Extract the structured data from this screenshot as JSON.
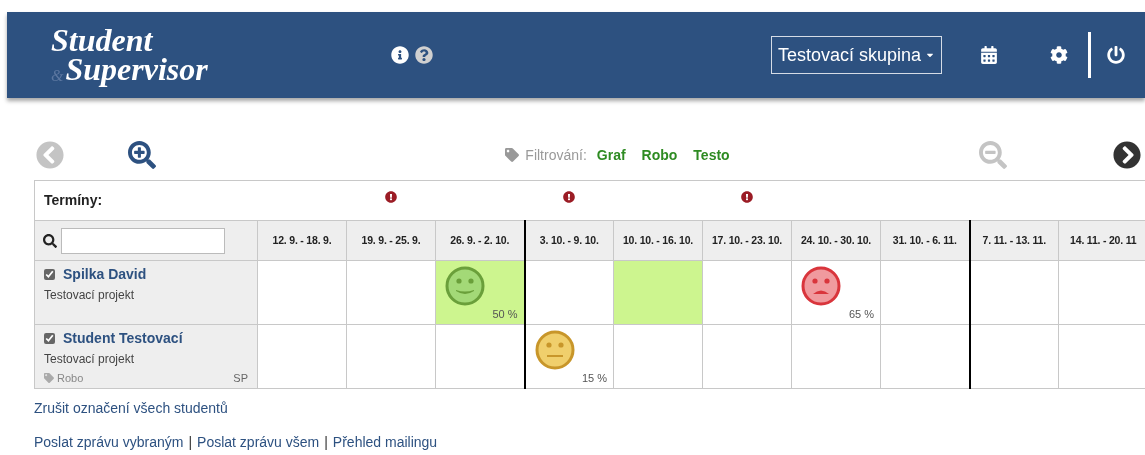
{
  "header": {
    "logo_top": "Student",
    "logo_amp": "&",
    "logo_bottom": "Supervisor",
    "group_select": "Testovací skupina"
  },
  "toolbar": {
    "filter_label": "Filtrování:",
    "filters": [
      "Graf",
      "Robo",
      "Testo"
    ],
    "prev_disabled": true,
    "zoom_out_disabled": true
  },
  "table": {
    "deadlines_label": "Termíny:",
    "weeks": [
      {
        "label": "12. 9. - 18. 9.",
        "deadline": false,
        "divider_before": false
      },
      {
        "label": "19. 9. - 25. 9.",
        "deadline": true,
        "divider_before": false
      },
      {
        "label": "26. 9. - 2. 10.",
        "deadline": false,
        "divider_before": false
      },
      {
        "label": "3. 10. - 9. 10.",
        "deadline": true,
        "divider_before": true
      },
      {
        "label": "10. 10. - 16. 10.",
        "deadline": false,
        "divider_before": false
      },
      {
        "label": "17. 10. - 23. 10.",
        "deadline": true,
        "divider_before": false
      },
      {
        "label": "24. 10. - 30. 10.",
        "deadline": false,
        "divider_before": false
      },
      {
        "label": "31. 10. - 6. 11.",
        "deadline": false,
        "divider_before": false
      },
      {
        "label": "7. 11. - 13. 11.",
        "deadline": false,
        "divider_before": true
      },
      {
        "label": "14. 11. - 20. 11",
        "deadline": false,
        "divider_before": false
      }
    ],
    "students": [
      {
        "name": "Spilka David",
        "checked": true,
        "project": "Testovací projekt",
        "cells": [
          {
            "kind": "empty",
            "highlight": false
          },
          {
            "kind": "empty",
            "highlight": false
          },
          {
            "kind": "happy",
            "highlight": true,
            "percent": "50 %"
          },
          {
            "kind": "empty",
            "highlight": false
          },
          {
            "kind": "empty",
            "highlight": true
          },
          {
            "kind": "empty",
            "highlight": false
          },
          {
            "kind": "sad",
            "highlight": false,
            "percent": "65 %"
          },
          {
            "kind": "empty",
            "highlight": false
          },
          {
            "kind": "empty",
            "highlight": false
          },
          {
            "kind": "empty",
            "highlight": false
          }
        ]
      },
      {
        "name": "Student Testovací",
        "checked": true,
        "project": "Testovací projekt",
        "tag": "Robo",
        "initials": "SP",
        "cells": [
          {
            "kind": "empty",
            "highlight": false
          },
          {
            "kind": "empty",
            "highlight": false
          },
          {
            "kind": "empty",
            "highlight": false
          },
          {
            "kind": "neutral",
            "highlight": false,
            "percent": "15 %"
          },
          {
            "kind": "empty",
            "highlight": false
          },
          {
            "kind": "empty",
            "highlight": false
          },
          {
            "kind": "empty",
            "highlight": false
          },
          {
            "kind": "empty",
            "highlight": false
          },
          {
            "kind": "empty",
            "highlight": false
          },
          {
            "kind": "empty",
            "highlight": false
          }
        ]
      }
    ]
  },
  "unselect_link": "Zrušit označení všech studentů",
  "footer_separator": "|",
  "footer_links": [
    "Poslat zprávu vybraným",
    "Poslat zprávu všem",
    "Přehled mailingu"
  ]
}
